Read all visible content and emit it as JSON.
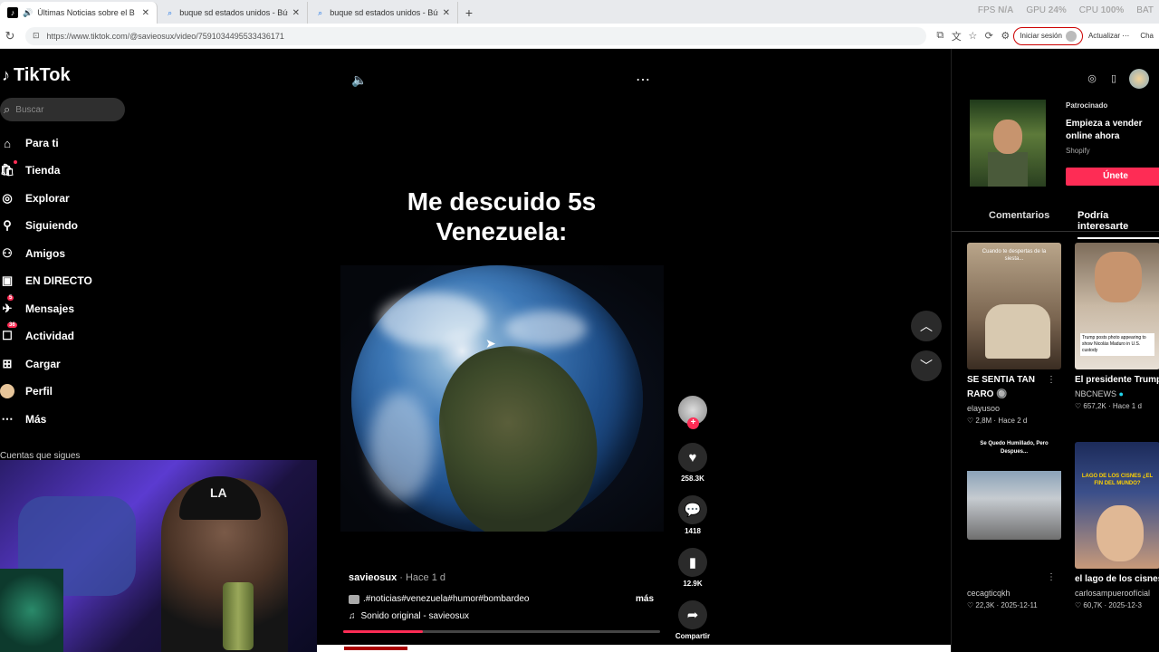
{
  "browser": {
    "tabs": [
      {
        "title": "Últimas Noticias sobre el Bom",
        "icon": "tiktok-icon",
        "close": "✕"
      },
      {
        "title": "buque sd estados unidos - Búsque",
        "icon": "search-icon",
        "close": "✕"
      },
      {
        "title": "buque sd estados unidos - Búsque",
        "icon": "search-icon",
        "close": "✕"
      }
    ],
    "new_tab": "+",
    "url": "https://www.tiktok.com/@savieosux/video/7591034495533436171",
    "perf": [
      {
        "label": "FPS",
        "value": "N/A"
      },
      {
        "label": "GPU",
        "value": "24%"
      },
      {
        "label": "CPU",
        "value": "100%"
      },
      {
        "label": "BAT",
        "value": ""
      }
    ],
    "signin": "Iniciar sesión",
    "update": "Actualizar",
    "chat": "Cha"
  },
  "sidebar": {
    "logo": "TikTok",
    "search_placeholder": "Buscar",
    "items": [
      {
        "label": "Para ti",
        "icon": "home-icon",
        "badge": ""
      },
      {
        "label": "Tienda",
        "icon": "shop-icon",
        "badge": ""
      },
      {
        "label": "Explorar",
        "icon": "compass-icon",
        "badge": ""
      },
      {
        "label": "Siguiendo",
        "icon": "following-icon",
        "badge": ""
      },
      {
        "label": "Amigos",
        "icon": "friends-icon",
        "badge": ""
      },
      {
        "label": "EN DIRECTO",
        "icon": "live-icon",
        "badge": ""
      },
      {
        "label": "Mensajes",
        "icon": "messages-icon",
        "badge": "5"
      },
      {
        "label": "Actividad",
        "icon": "activity-icon",
        "badge": "36"
      },
      {
        "label": "Cargar",
        "icon": "upload-icon",
        "badge": ""
      },
      {
        "label": "Perfil",
        "icon": "avatar-icon",
        "badge": ""
      },
      {
        "label": "Más",
        "icon": "more-icon",
        "badge": ""
      }
    ],
    "following_header": "Cuentas que sigues"
  },
  "video": {
    "caption": "Me descuido 5s\nVenezuela:",
    "username": "savieosux",
    "time": " · Hace 1 d",
    "description": ".#noticias#venezuela#humor#bombardeo",
    "more": "más",
    "sound": "Sonido original - savieosux",
    "progress": 0.25,
    "likes": "258.3K",
    "comments": "1418",
    "saves": "12.9K",
    "share": "Compartir"
  },
  "right": {
    "ad": {
      "sponsored": "Patrocinado",
      "title": "Empieza a vender online ahora",
      "brand": "Shopify",
      "cta": "Únete"
    },
    "tabs": [
      "Comentarios",
      "Podría interesarte"
    ],
    "cards": [
      {
        "title": "SE SENTIA TAN RARO 🔘",
        "user": "elayusoo",
        "likes": "2,8M",
        "date": "Hace 2 d"
      },
      {
        "title": "El presidente Trump publicó un...",
        "user": "NBCNEWS",
        "likes": "657,2K",
        "date": "Hace 1 d"
      },
      {
        "title": "",
        "user": "cecagticqkh",
        "likes": "22,3K",
        "date": "2025-12-11"
      },
      {
        "title": "el lago de los cisnes suena en...",
        "user": "carlosampueroofícial",
        "likes": "60,7K",
        "date": "2025-12-3"
      }
    ],
    "thumb_texts": [
      "Cuando te despertas de la siesta...",
      "Trump posts photo appearing to show Nicolás Maduro in U.S. custody",
      "Se Quedo Humillado, Pero Despues...",
      "LAGO DE LOS CISNES ¿EL FIN DEL MUNDO?"
    ]
  },
  "colors": {
    "accent": "#fe2c55",
    "bg": "#000000"
  }
}
